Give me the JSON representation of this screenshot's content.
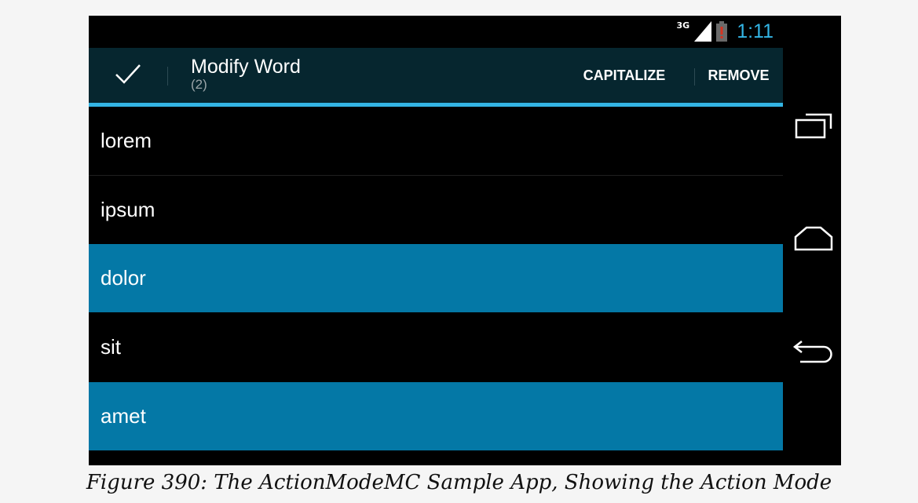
{
  "status_bar": {
    "network": "3G",
    "time": "1:11",
    "icons": [
      "signal-icon",
      "battery-alert-icon"
    ]
  },
  "action_mode": {
    "done_icon": "checkmark-icon",
    "title": "Modify Word",
    "subtitle": "(2)",
    "actions": [
      "CAPITALIZE",
      "REMOVE"
    ]
  },
  "list": {
    "items": [
      {
        "label": "lorem",
        "checked": false
      },
      {
        "label": "ipsum",
        "checked": false
      },
      {
        "label": "dolor",
        "checked": true
      },
      {
        "label": "sit",
        "checked": false
      },
      {
        "label": "amet",
        "checked": true
      }
    ]
  },
  "nav_bar": {
    "icons": [
      "recent-apps-icon",
      "home-icon",
      "back-icon"
    ]
  },
  "caption": "Figure 390: The ActionModeMC Sample App, Showing the Action Mode",
  "colors": {
    "accent": "#33b5e5",
    "selected_row": "#0478a6",
    "action_bar": "#06262f",
    "battery_alert": "#d8331f"
  }
}
